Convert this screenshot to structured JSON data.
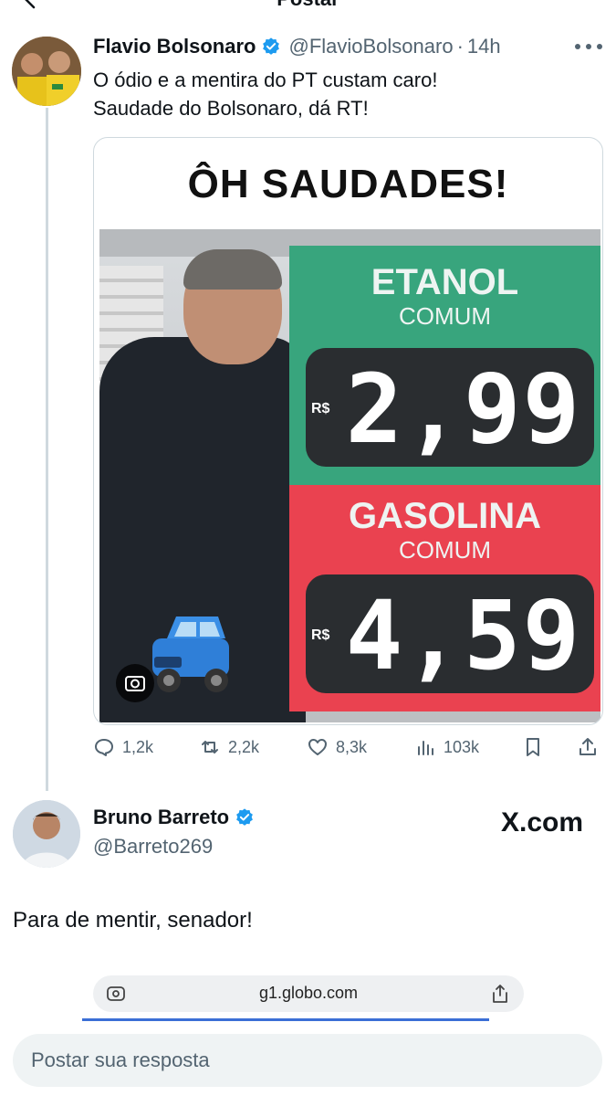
{
  "header": {
    "title": "Postar"
  },
  "tweet": {
    "author_name": "Flavio Bolsonaro",
    "handle": "@FlavioBolsonaro",
    "separator": "·",
    "time": "14h",
    "text_lines": [
      "O ódio e a mentira do PT custam caro!",
      "Saudade do Bolsonaro, dá RT!"
    ],
    "media": {
      "headline": "ÔH SAUDADES!",
      "fuel_top": {
        "name": "ETANOL",
        "sub": "COMUM",
        "currency": "R$",
        "price": "2,99"
      },
      "fuel_bottom": {
        "name": "GASOLINA",
        "sub": "COMUM",
        "currency": "R$",
        "price": "4,59"
      }
    },
    "stats": {
      "replies": "1,2k",
      "retweets": "2,2k",
      "likes": "8,3k",
      "views": "103k"
    },
    "colors": {
      "accent": "#1d9bf0",
      "muted": "#536471",
      "board_green": "#38a57d",
      "board_red": "#ea4250"
    }
  },
  "reply_tweet": {
    "author_name": "Bruno Barreto",
    "handle": "@Barreto269",
    "watermark": "X.com",
    "text": "Para de mentir, senador!",
    "embed_url": "g1.globo.com"
  },
  "composer": {
    "placeholder": "Postar sua resposta"
  }
}
